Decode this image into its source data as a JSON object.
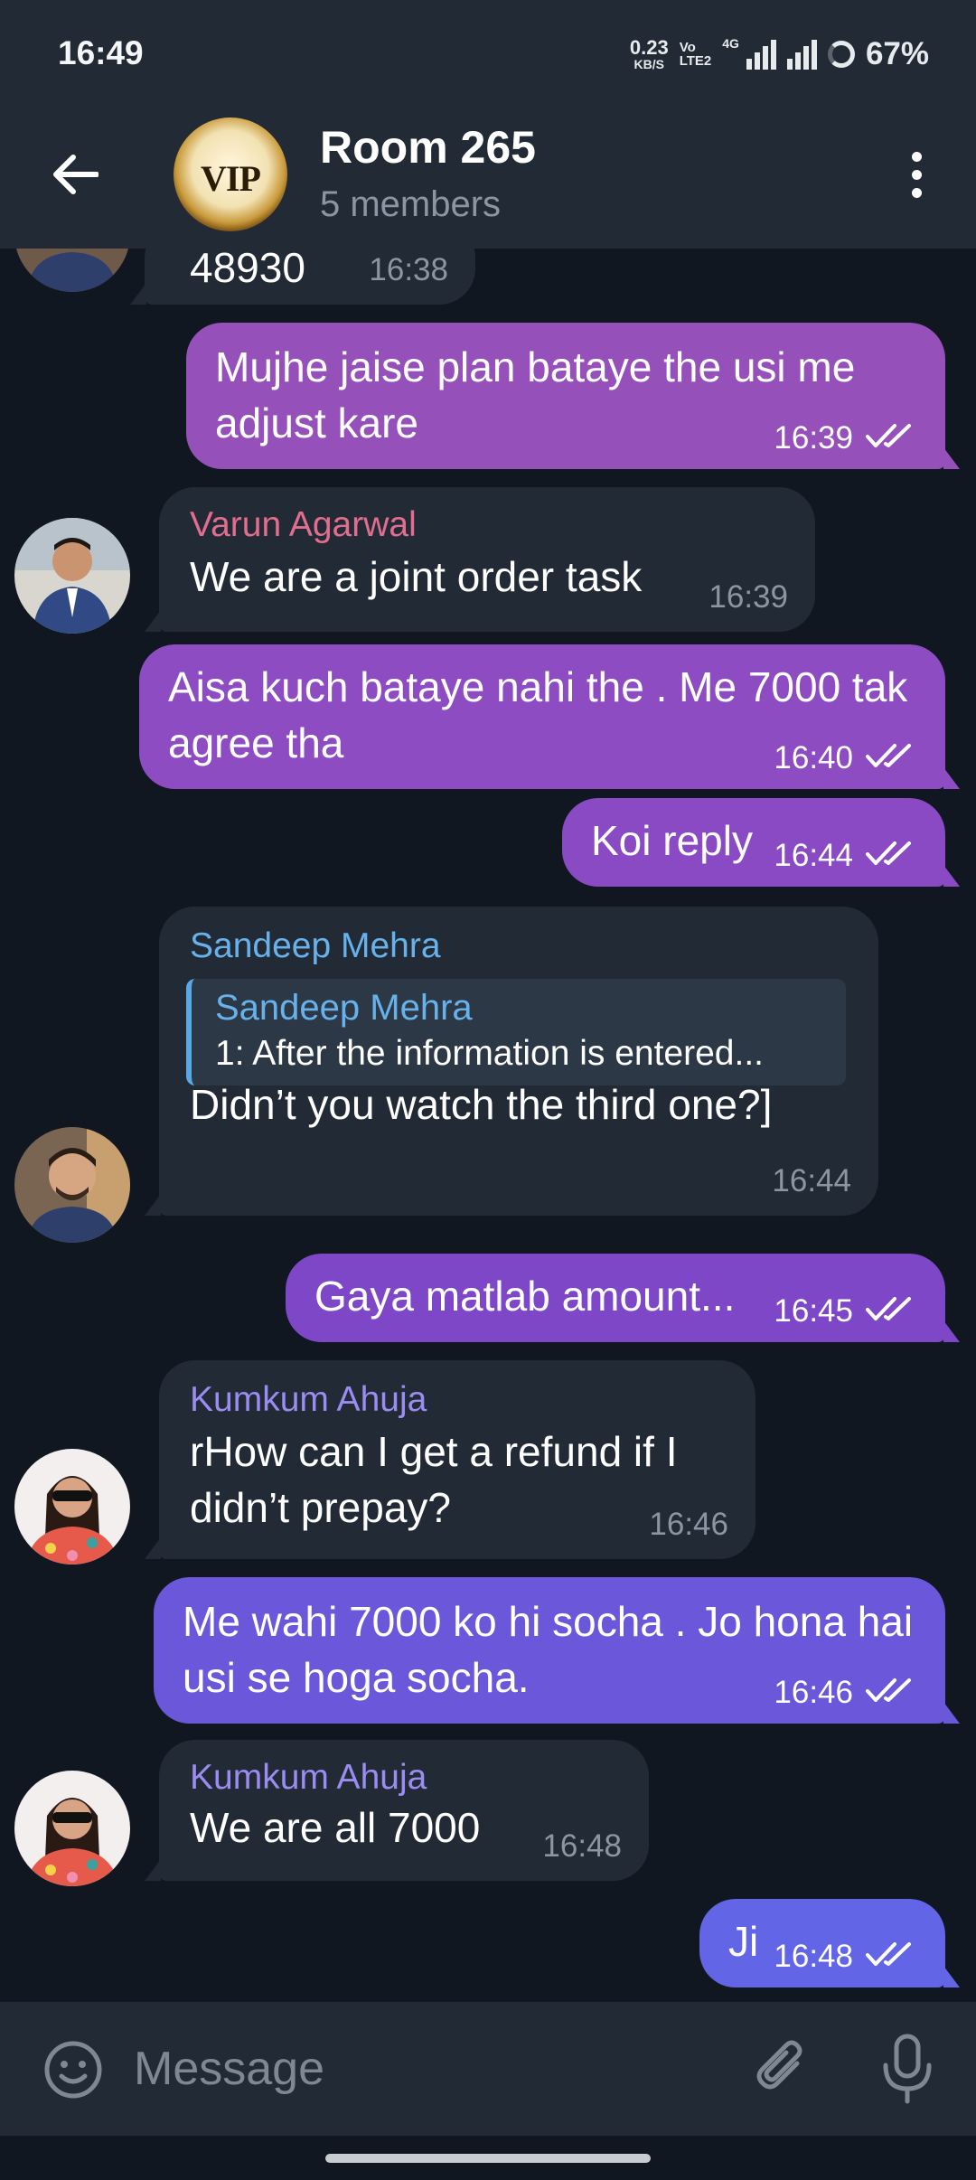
{
  "status_bar": {
    "time": "16:49",
    "net_speed_value": "0.23",
    "net_speed_unit": "KB/S",
    "volte_top": "Vo",
    "volte_bottom": "LTE2",
    "network_type": "4G",
    "battery": "67%"
  },
  "header": {
    "avatar_text": "VIP",
    "title": "Room 265",
    "subtitle": "5 members"
  },
  "messages": [
    {
      "type": "in",
      "text": "48930",
      "time": "16:38"
    },
    {
      "type": "out",
      "text": "Mujhe jaise plan bataye the usi me adjust kare",
      "time": "16:39",
      "color": "#9650b9"
    },
    {
      "type": "in",
      "sender": "Varun Agarwal",
      "sender_color": "#e26e8f",
      "text": "We are a joint order task",
      "time": "16:39"
    },
    {
      "type": "out",
      "text": "Aisa kuch bataye nahi the . Me 7000 tak agree tha",
      "time": "16:40",
      "color": "#8d4cc1"
    },
    {
      "type": "out",
      "text": "Koi reply",
      "time": "16:44",
      "color": "#8a4ac4"
    },
    {
      "type": "in",
      "sender": "Sandeep Mehra",
      "sender_color": "#67b2eb",
      "reply_name": "Sandeep Mehra",
      "reply_text": "1: After the information is entered...",
      "text": "Didn’t you watch the third one?]",
      "time": "16:44"
    },
    {
      "type": "out",
      "text": "Gaya matlab amount...",
      "time": "16:45",
      "color": "#7d47c8"
    },
    {
      "type": "in",
      "sender": "Kumkum Ahuja",
      "sender_color": "#9a8cf0",
      "text": "rHow can I get a refund if I didn’t prepay?",
      "time": "16:46"
    },
    {
      "type": "out",
      "text": "Me wahi 7000 ko hi socha . Jo hona hai usi se hoga socha.",
      "time": "16:46",
      "color": "#6b57d9"
    },
    {
      "type": "in",
      "sender": "Kumkum Ahuja",
      "sender_color": "#9a8cf0",
      "text": "We are all 7000",
      "time": "16:48"
    },
    {
      "type": "out",
      "text": "Ji",
      "time": "16:48",
      "color": "#6265e6"
    }
  ],
  "input": {
    "placeholder": "Message"
  }
}
